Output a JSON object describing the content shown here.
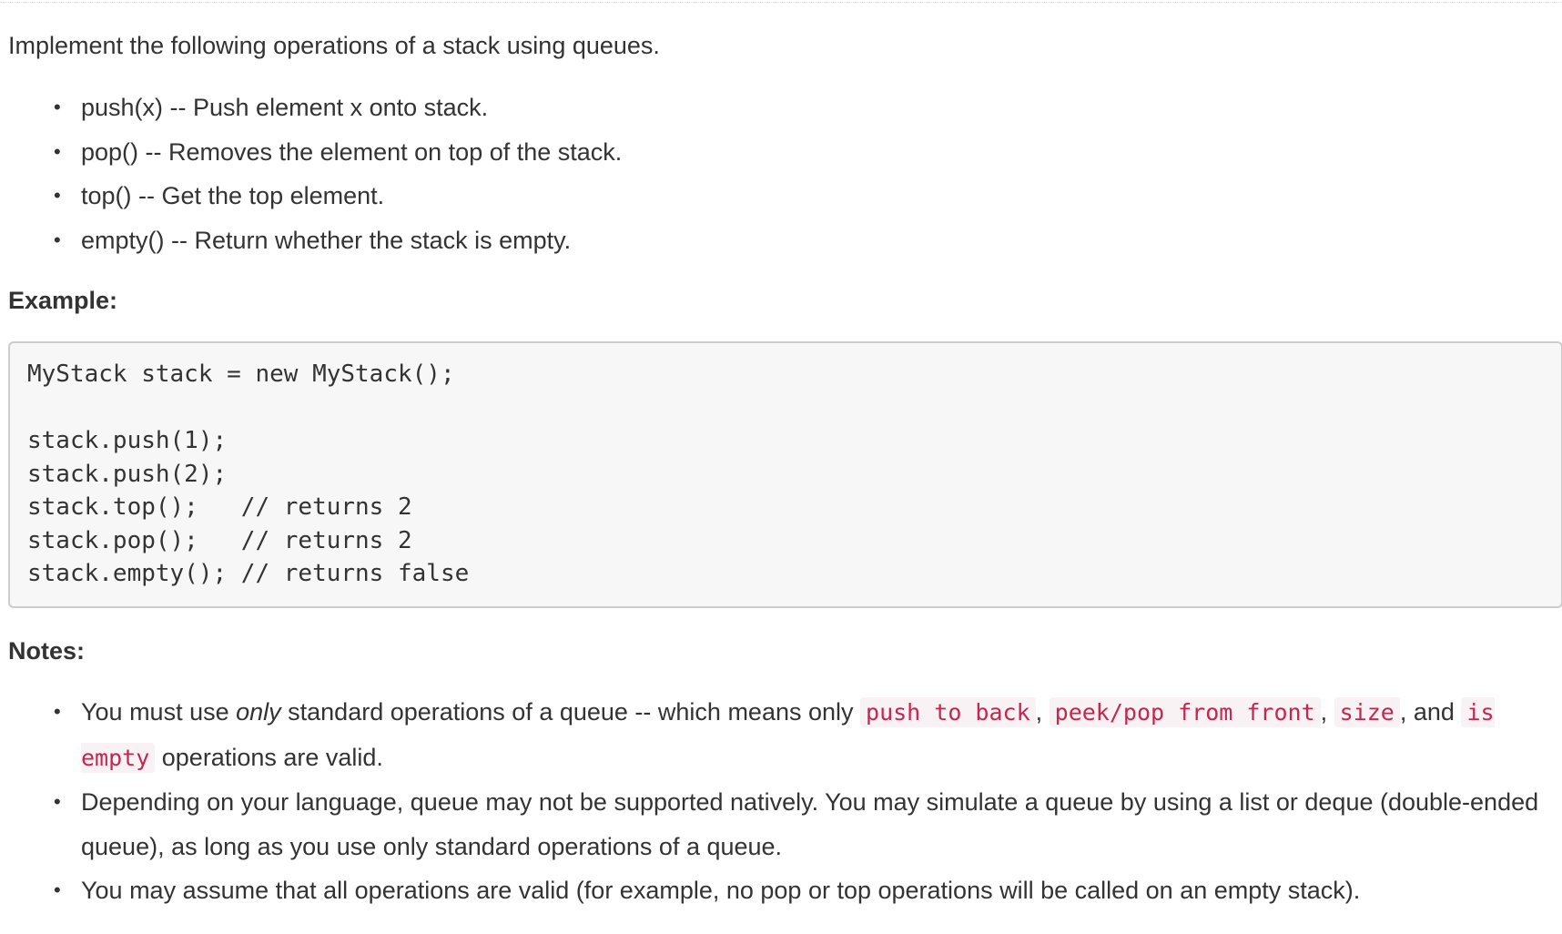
{
  "intro": "Implement the following operations of a stack using queues.",
  "operations": [
    "push(x) -- Push element x onto stack.",
    "pop() -- Removes the element on top of the stack.",
    "top() -- Get the top element.",
    "empty() -- Return whether the stack is empty."
  ],
  "example_heading": "Example:",
  "example_code": "MyStack stack = new MyStack();\n\nstack.push(1);\nstack.push(2);\nstack.top();   // returns 2\nstack.pop();   // returns 2\nstack.empty(); // returns false",
  "notes_heading": "Notes:",
  "notes": {
    "note1": {
      "part1": "You must use ",
      "emphasis": "only",
      "part2": " standard operations of a queue -- which means only ",
      "code1": "push to back",
      "sep1": ", ",
      "code2": "peek/pop from front",
      "sep2": ", ",
      "code3": "size",
      "part3": ", and ",
      "code4": "is empty",
      "part4": " operations are valid."
    },
    "note2": "Depending on your language, queue may not be supported natively. You may simulate a queue by using a list or deque (double-ended queue), as long as you use only standard operations of a queue.",
    "note3": "You may assume that all operations are valid (for example, no pop or top operations will be called on an empty stack)."
  },
  "bullet_glyph": "•"
}
